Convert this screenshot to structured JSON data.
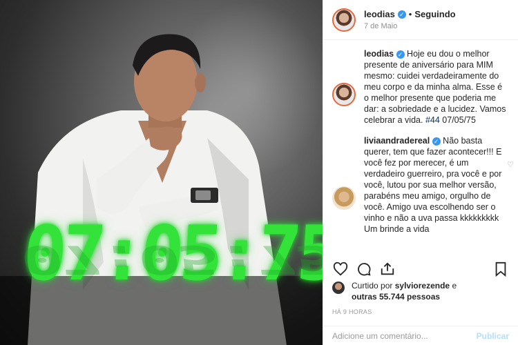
{
  "post": {
    "username": "leodias",
    "separator": "•",
    "follow_status": "Seguindo",
    "date": "7 de Maio"
  },
  "photo": {
    "clock_text": "07:05:75"
  },
  "caption": {
    "username": "leodias",
    "text": "Hoje eu dou o melhor presente de aniversário para MIM mesmo: cuidei verdadeiramente do meu corpo e da minha alma. Esse é o melhor presente que poderia me dar: a sobriedade e a lucidez. Vamos celebrar a vida.",
    "hashtag": "#44",
    "tail": "07/05/75"
  },
  "comment": {
    "username": "liviaandradereal",
    "text": "Não basta querer, tem que fazer acontecer!!! E você fez por merecer, é um verdadeiro guerreiro, pra você e por você, lutou por sua melhor versão, parabéns meu amigo, orgulho de você. Amigo uva escolhendo ser o vinho e não a uva passa kkkkkkkkk Um brinde a vida"
  },
  "likes": {
    "prefix": "Curtido por",
    "liker": "sylviorezende",
    "mid": "e",
    "others": "outras 55.744 pessoas"
  },
  "timestamp": "HÁ 9 HORAS",
  "add_comment": {
    "placeholder": "Adicione um comentário...",
    "publish": "Publicar"
  },
  "icons": {
    "like": "heart-icon",
    "comment": "comment-icon",
    "share": "share-icon",
    "save": "bookmark-icon",
    "verified": "verified-icon"
  },
  "colors": {
    "verified": "#3897f0",
    "hashtag": "#003569",
    "clock": "#33e33a",
    "publish_disabled": "#b2dffc"
  }
}
